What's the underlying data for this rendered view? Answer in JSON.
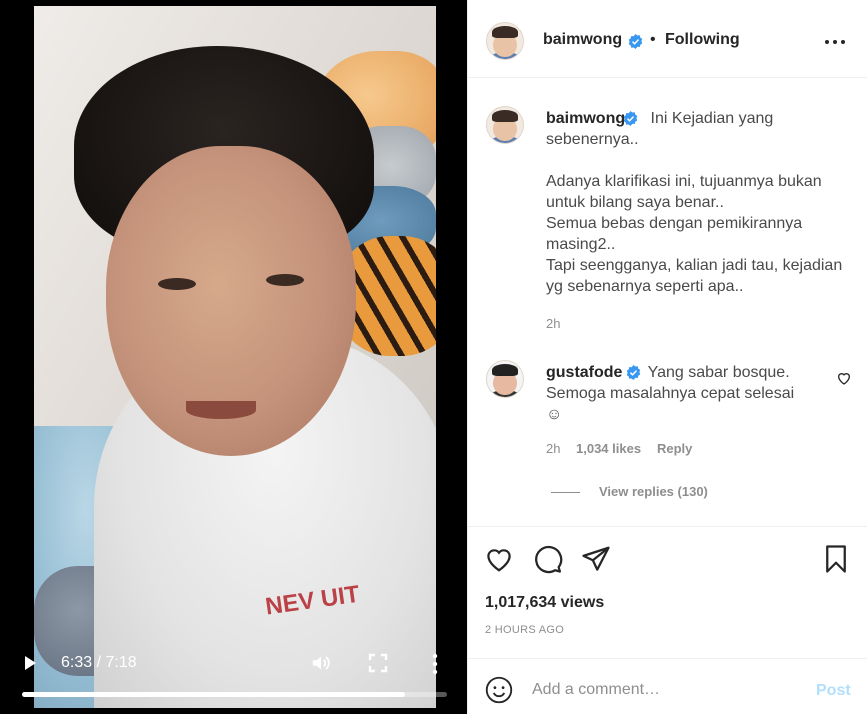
{
  "video": {
    "time": "6:33 / 7:18",
    "progress": 0.9,
    "shirt_print": "NEV   UIT",
    "icons": [
      "play-icon",
      "volume-icon",
      "fullscreen-icon",
      "more-vertical-icon"
    ]
  },
  "header": {
    "username": "baimwong",
    "separator": "•",
    "follow_status": "Following",
    "icons": [
      "verified-badge-icon",
      "more-options-icon"
    ]
  },
  "caption": {
    "username": "baimwong",
    "text": " Ini Kejadian yang sebenernya..\n\nAdanya klarifikasi ini, tujuanmya bukan untuk bilang saya benar..\nSemua bebas dengan pemikirannya masing2..\nTapi seengganya, kalian jadi tau, kejadian yg sebenarnya seperti apa..",
    "time": "2h"
  },
  "comment": {
    "username": "gustafode",
    "text": " Yang sabar bosque.\nSemoga masalahnya cepat selesai\n☺",
    "time": "2h",
    "likes": "1,034 likes",
    "reply": "Reply",
    "view_replies": "View replies (130)"
  },
  "actions": {
    "icons": [
      "heart-icon",
      "comment-icon",
      "share-icon",
      "bookmark-icon"
    ]
  },
  "stats": {
    "views": "1,017,634 views",
    "posted": "2 HOURS AGO"
  },
  "add_comment": {
    "placeholder": "Add a comment…",
    "post_label": "Post",
    "icons": [
      "emoji-icon"
    ]
  },
  "colors": {
    "verified": "#3897f0",
    "post_disabled": "#b2dffc",
    "muted": "#8e8e8e"
  }
}
